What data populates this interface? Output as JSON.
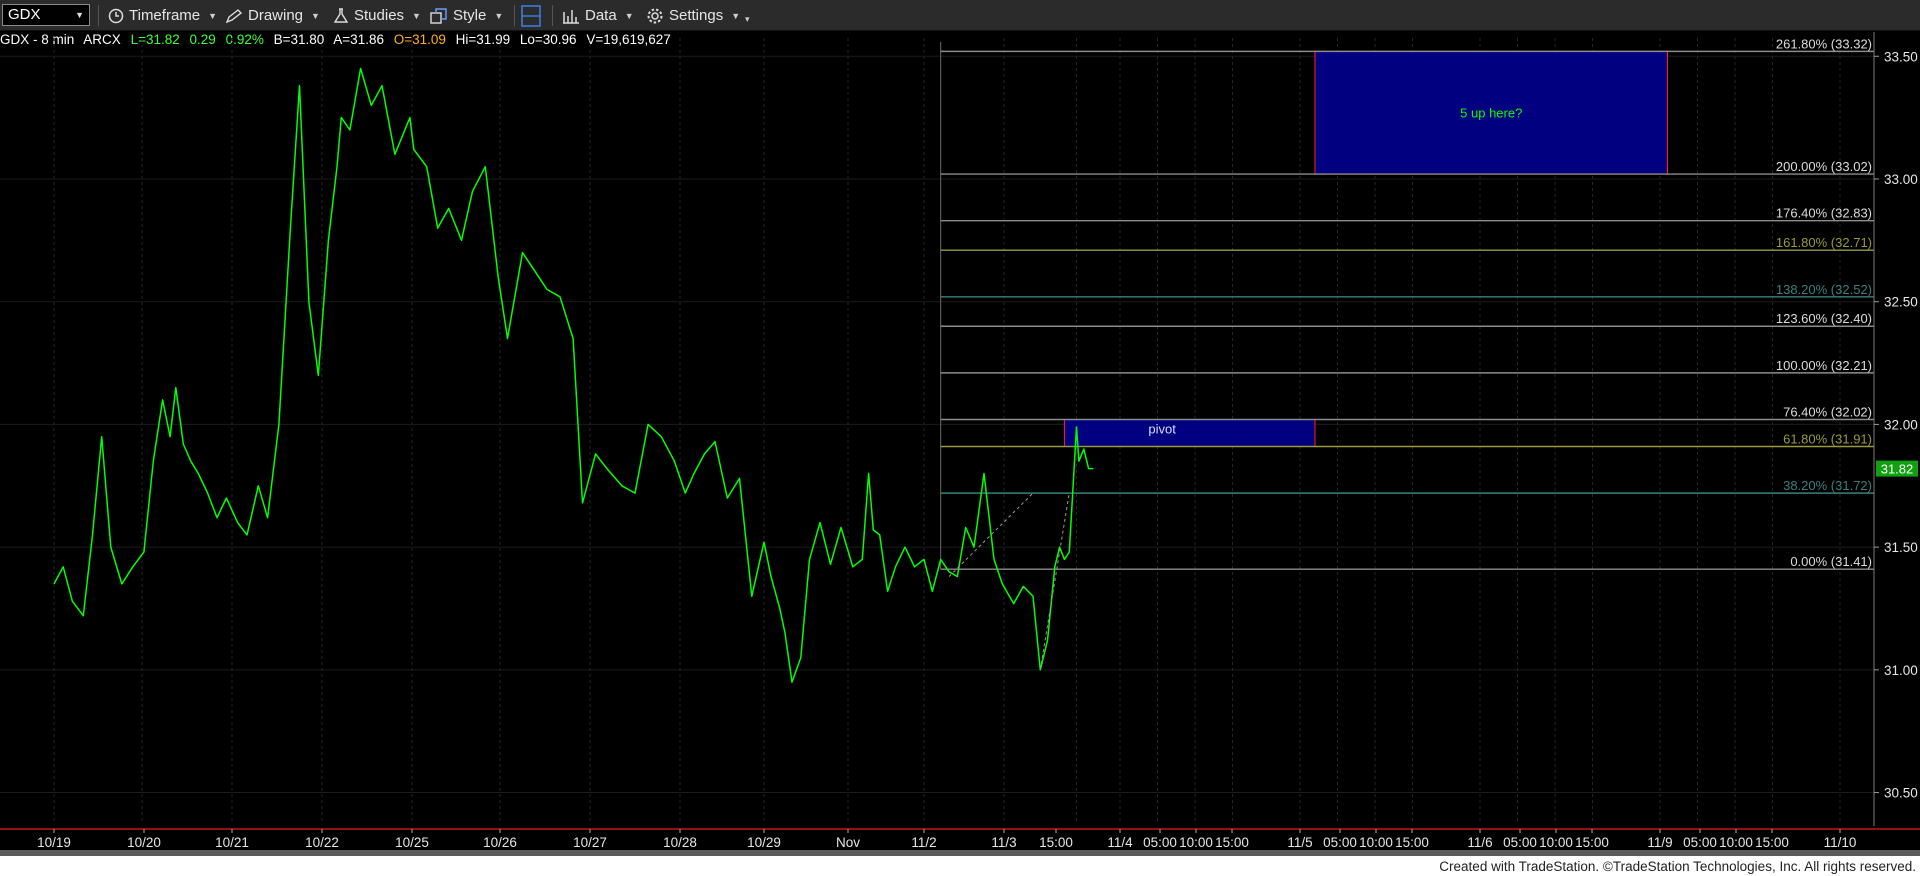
{
  "toolbar": {
    "symbol": "GDX",
    "timeframe_label": "Timeframe",
    "drawing_label": "Drawing",
    "studies_label": "Studies",
    "style_label": "Style",
    "data_label": "Data",
    "settings_label": "Settings"
  },
  "info_bar": {
    "symbol_interval": "GDX - 8 min",
    "exchange": "ARCX",
    "last": "L=31.82",
    "change": "0.29",
    "change_pct": "0.92%",
    "bid": "B=31.80",
    "ask": "A=31.86",
    "open": "O=31.09",
    "high": "Hi=31.99",
    "low": "Lo=30.96",
    "volume": "V=19,619,627"
  },
  "colors": {
    "background": "#000000",
    "price_line": "#00ff00",
    "grid": "#262626",
    "zone_fill": "#000080",
    "zone_border": "#ff2020",
    "fib_gray": "#8c8c8c",
    "fib_olive": "#9a9a3c",
    "fib_teal": "#3a8080",
    "up_green": "#00ff00",
    "last_price_tag": "#10a010"
  },
  "annotations": {
    "pivot_label": "pivot",
    "target_label": "5 up here?"
  },
  "footer": {
    "text": "Created with TradeStation. ©TradeStation Technologies, Inc. All rights reserved."
  },
  "chart_data": {
    "type": "line",
    "title": "",
    "xlabel": "",
    "ylabel": "",
    "ylim": [
      30.38,
      33.55
    ],
    "y_ticks": [
      "33.50",
      "33.00",
      "32.50",
      "32.00",
      "31.50",
      "31.00",
      "30.50"
    ],
    "x_tick_labels": [
      "10/19",
      "10/20",
      "10/21",
      "10/22",
      "10/25",
      "10/26",
      "10/27",
      "10/28",
      "10/29",
      "Nov",
      "11/2",
      "11/3",
      "15:00",
      "11/4",
      "05:00",
      "10:00",
      "15:00",
      "11/5",
      "05:00",
      "10:00",
      "15:00",
      "11/6",
      "05:00",
      "10:00",
      "15:00",
      "11/9",
      "05:00",
      "10:00",
      "15:00",
      "11/10"
    ],
    "last_price": "31.82",
    "series": [
      {
        "x": [
          "10/19 00:00",
          "10/19 02:30",
          "10/19 05:00",
          "10/19 08:00",
          "10/19 10:30",
          "10/19 13:00",
          "10/19 15:30",
          "10/19 18:30",
          "10/19 21:30",
          "10/20 00:30",
          "10/20 03:00",
          "10/20 05:30",
          "10/20 07:30",
          "10/20 09:00",
          "10/20 11:00",
          "10/20 13:00",
          "10/20 15:00",
          "10/20 17:30",
          "10/20 20:00",
          "10/20 22:30",
          "10/21 01:30",
          "10/21 04:00",
          "10/21 07:00",
          "10/21 09:30",
          "10/21 12:30",
          "10/21 15:30",
          "10/21 18:00",
          "10/21 20:30",
          "10/21 23:00",
          "10/22 01:30",
          "10/22 03:30",
          "10/22 04:30",
          "10/22 06:30",
          "10/22 09:00",
          "10/22 11:30",
          "10/22 14:00",
          "10/22 17:00",
          "10/22 20:30",
          "10/25 00:30",
          "10/25 04:00",
          "10/25 07:00",
          "10/25 10:00",
          "10/25 13:30",
          "10/25 16:30",
          "10/25 20:00",
          "10/25 23:30",
          "10/26 02:00",
          "10/26 06:00",
          "10/26 09:30",
          "10/26 12:30",
          "10/26 16:00",
          "10/26 19:30",
          "10/26 22:00",
          "10/27 01:30",
          "10/27 04:30",
          "10/27 08:30",
          "10/27 12:00",
          "10/27 15:30",
          "10/27 19:00",
          "10/27 22:30",
          "10/28 01:30",
          "10/28 04:00",
          "10/28 07:00",
          "10/28 10:00",
          "10/28 13:30",
          "10/28 17:00",
          "10/28 20:30",
          "10/29 00:00",
          "10/29 02:00",
          "10/29 04:30",
          "10/29 06:00",
          "10/29 08:00",
          "10/29 10:30",
          "10/29 13:00",
          "10/29 16:00",
          "10/29 19:00",
          "10/29 22:00",
          "Nov 01:30",
          "Nov 04:30",
          "Nov 06:30",
          "Nov 08:00",
          "Nov 10:00",
          "Nov 12:30",
          "Nov 15:00",
          "Nov 18:00",
          "Nov 21:00",
          "11/2 00:00",
          "11/2 02:30",
          "11/2 05:00",
          "11/2 07:30",
          "11/2 10:00",
          "11/2 12:30",
          "11/2 15:00",
          "11/2 18:00",
          "11/2 21:00",
          "11/2 23:30",
          "11/3 02:00",
          "11/3 04:00",
          "11/3 06:00",
          "11/3 07:30",
          "11/3 09:00",
          "11/3 10:30",
          "11/3 11:30",
          "11/3 12:30",
          "11/3 13:30",
          "11/3 14:30",
          "11/3 15:00",
          "11/3 15:30",
          "11/3 16:30",
          "11/3 17:30",
          "11/3 18:30"
        ],
        "values": [
          31.35,
          31.42,
          31.28,
          31.22,
          31.55,
          31.95,
          31.5,
          31.35,
          31.42,
          31.48,
          31.85,
          32.1,
          31.95,
          32.15,
          31.92,
          31.85,
          31.8,
          31.72,
          31.62,
          31.7,
          31.6,
          31.55,
          31.75,
          31.62,
          32.0,
          32.78,
          33.38,
          32.5,
          32.2,
          32.75,
          33.05,
          33.25,
          33.2,
          33.45,
          33.3,
          33.38,
          33.1,
          33.25,
          33.12,
          33.05,
          32.8,
          32.88,
          32.75,
          32.95,
          33.05,
          32.6,
          32.35,
          32.7,
          32.62,
          32.55,
          32.52,
          32.35,
          31.68,
          31.88,
          31.82,
          31.75,
          31.72,
          32.0,
          31.95,
          31.85,
          31.72,
          31.8,
          31.88,
          31.93,
          31.7,
          31.78,
          31.3,
          31.52,
          31.38,
          31.25,
          31.15,
          30.95,
          31.05,
          31.45,
          31.6,
          31.43,
          31.58,
          31.42,
          31.45,
          31.8,
          31.57,
          31.55,
          31.32,
          31.42,
          31.5,
          31.42,
          31.45,
          31.32,
          31.45,
          31.4,
          31.38,
          31.58,
          31.5,
          31.8,
          31.45,
          31.35,
          31.27,
          31.34,
          31.3,
          31.0,
          31.12,
          31.42,
          31.5,
          31.45,
          31.48,
          31.82,
          31.99,
          31.85,
          31.9,
          31.82,
          31.82
        ]
      }
    ],
    "fib_levels": [
      {
        "label": "261.80% (33.32)",
        "value": 33.52,
        "color": "#8c8c8c"
      },
      {
        "label": "200.00% (33.02)",
        "value": 33.02,
        "color": "#8c8c8c"
      },
      {
        "label": "176.40% (32.83)",
        "value": 32.83,
        "color": "#8c8c8c"
      },
      {
        "label": "161.80% (32.71)",
        "value": 32.71,
        "color": "#9a9a3c"
      },
      {
        "label": "138.20% (32.52)",
        "value": 32.52,
        "color": "#3a8080"
      },
      {
        "label": "123.60% (32.40)",
        "value": 32.4,
        "color": "#8c8c8c"
      },
      {
        "label": "100.00% (32.21)",
        "value": 32.21,
        "color": "#8c8c8c"
      },
      {
        "label": "76.40% (32.02)",
        "value": 32.02,
        "color": "#8c8c8c"
      },
      {
        "label": "61.80% (31.91)",
        "value": 31.91,
        "color": "#9a9a3c"
      },
      {
        "label": "38.20% (31.72)",
        "value": 31.72,
        "color": "#3a8080"
      },
      {
        "label": "0.00% (31.41)",
        "value": 31.41,
        "color": "#8c8c8c"
      }
    ],
    "zones": [
      {
        "label": "pivot",
        "from_x": "11/3 12:30",
        "to_x": "11/5 02:00",
        "low": 31.91,
        "high": 32.02
      },
      {
        "label": "5 up here?",
        "from_x": "11/5 02:00",
        "to_x": "11/9 01:00",
        "low": 33.02,
        "high": 33.52
      }
    ],
    "grid": true,
    "axis_position": "right"
  }
}
